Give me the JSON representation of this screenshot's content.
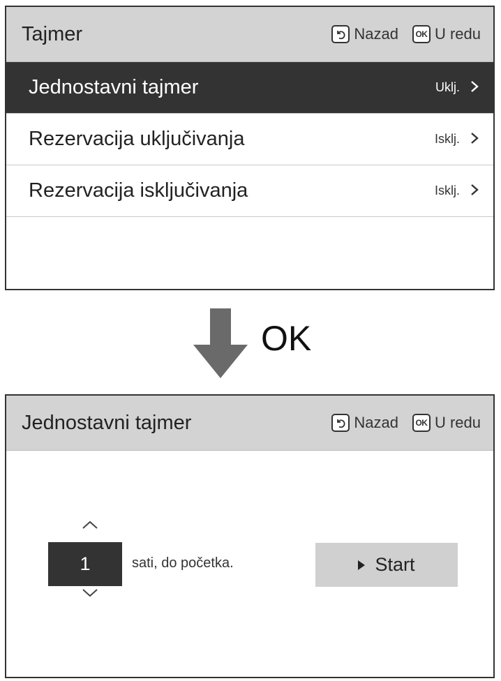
{
  "screen1": {
    "title": "Tajmer",
    "back_label": "Nazad",
    "ok_label": "U redu",
    "ok_icon_text": "OK",
    "items": [
      {
        "label": "Jednostavni tajmer",
        "status": "Uklj.",
        "selected": true
      },
      {
        "label": "Rezervacija uključivanja",
        "status": "Isklj."
      },
      {
        "label": "Rezervacija isključivanja",
        "status": "Isklj."
      }
    ]
  },
  "transition": {
    "label": "OK"
  },
  "screen2": {
    "title": "Jednostavni tajmer",
    "back_label": "Nazad",
    "ok_label": "U redu",
    "ok_icon_text": "OK",
    "hours_value": "1",
    "hours_label": "sati, do početka.",
    "start_label": "Start"
  },
  "icons": [
    "back-icon",
    "ok-icon",
    "chevron-right-icon",
    "arrow-down-icon",
    "chevron-up-icon",
    "chevron-down-icon",
    "play-icon"
  ],
  "colors": {
    "header_bg": "#d3d3d3",
    "selected_bg": "#333333",
    "button_bg": "#d0d0d0"
  }
}
